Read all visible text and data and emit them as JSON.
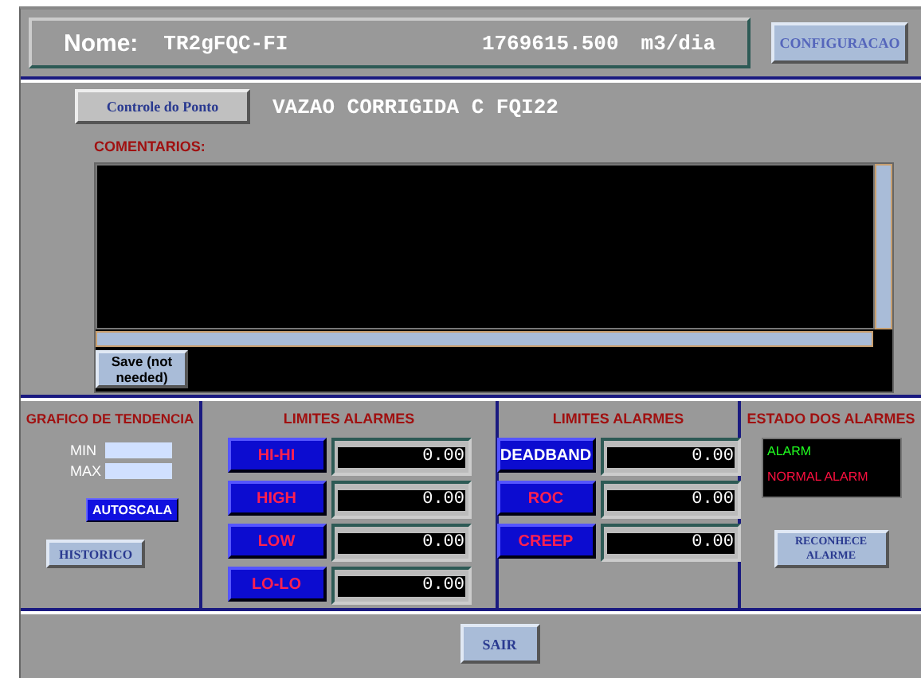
{
  "header": {
    "label": "Nome:",
    "tag": "TR2gFQC-FI",
    "value": "1769615.500",
    "unit": "m3/dia"
  },
  "config_button": "CONFIGURACAO",
  "point_control_button": "Controle do Ponto",
  "description": "VAZAO CORRIGIDA C FQI22",
  "comments": {
    "label": "COMENTARIOS:",
    "save_button": "Save (not needed)"
  },
  "trend": {
    "title": "GRAFICO DE TENDENCIA",
    "min_label": "MIN",
    "max_label": "MAX",
    "autoscale_button": "AUTOSCALA",
    "history_button": "HISTORICO"
  },
  "limits_1": {
    "title": "LIMITES ALARMES",
    "rows": [
      {
        "label": "HI-HI",
        "value": "0.00",
        "color": "#ff2050"
      },
      {
        "label": "HIGH",
        "value": "0.00",
        "color": "#ff2050"
      },
      {
        "label": "LOW",
        "value": "0.00",
        "color": "#ff2050"
      },
      {
        "label": "LO-LO",
        "value": "0.00",
        "color": "#ff2050"
      }
    ]
  },
  "limits_2": {
    "title": "LIMITES ALARMES",
    "rows": [
      {
        "label": "DEADBAND",
        "value": "0.00",
        "color": "#ffffff"
      },
      {
        "label": "ROC",
        "value": "0.00",
        "color": "#ff2050"
      },
      {
        "label": "CREEP",
        "value": "0.00",
        "color": "#ff2050"
      }
    ]
  },
  "alarm_state": {
    "title": "ESTADO DOS ALARMES",
    "lines": [
      {
        "text": "ALARM",
        "color": "#20ff20"
      },
      {
        "text": "NORMAL ALARM",
        "color": "#ff1040"
      }
    ],
    "ack_button": "RECONHECE ALARME"
  },
  "exit_button": "SAIR"
}
